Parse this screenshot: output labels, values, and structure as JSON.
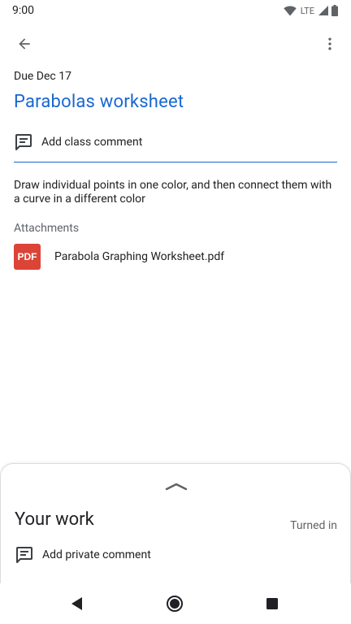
{
  "status_bar": {
    "time": "9:00",
    "network": "LTE",
    "icons": [
      "wifi-icon",
      "signal-icon",
      "battery-icon"
    ]
  },
  "app_bar": {
    "icons": [
      "back-arrow-icon",
      "more-vert-icon"
    ]
  },
  "assignment": {
    "due": "Due Dec 17",
    "title": "Parabolas worksheet",
    "instructions": "Draw individual points in one color, and then connect them with a curve in a different color"
  },
  "class_comment": {
    "label": "Add class comment",
    "icon": "comment-icon"
  },
  "attachments": {
    "heading": "Attachments",
    "items": [
      {
        "badge": "PDF",
        "name": "Parabola Graphing Worksheet.pdf",
        "icon": "pdf-icon"
      }
    ]
  },
  "your_work": {
    "title": "Your work",
    "status": "Turned in",
    "private_comment_label": "Add private comment",
    "icons": [
      "chevron-up-icon",
      "comment-icon"
    ]
  },
  "nav_bar": {
    "icons": [
      "nav-back-icon",
      "nav-home-icon",
      "nav-recents-icon"
    ]
  },
  "colors": {
    "accent": "#1967d2",
    "pdf_red": "#db4437",
    "text_primary": "#202124",
    "text_secondary": "#5f6368"
  }
}
